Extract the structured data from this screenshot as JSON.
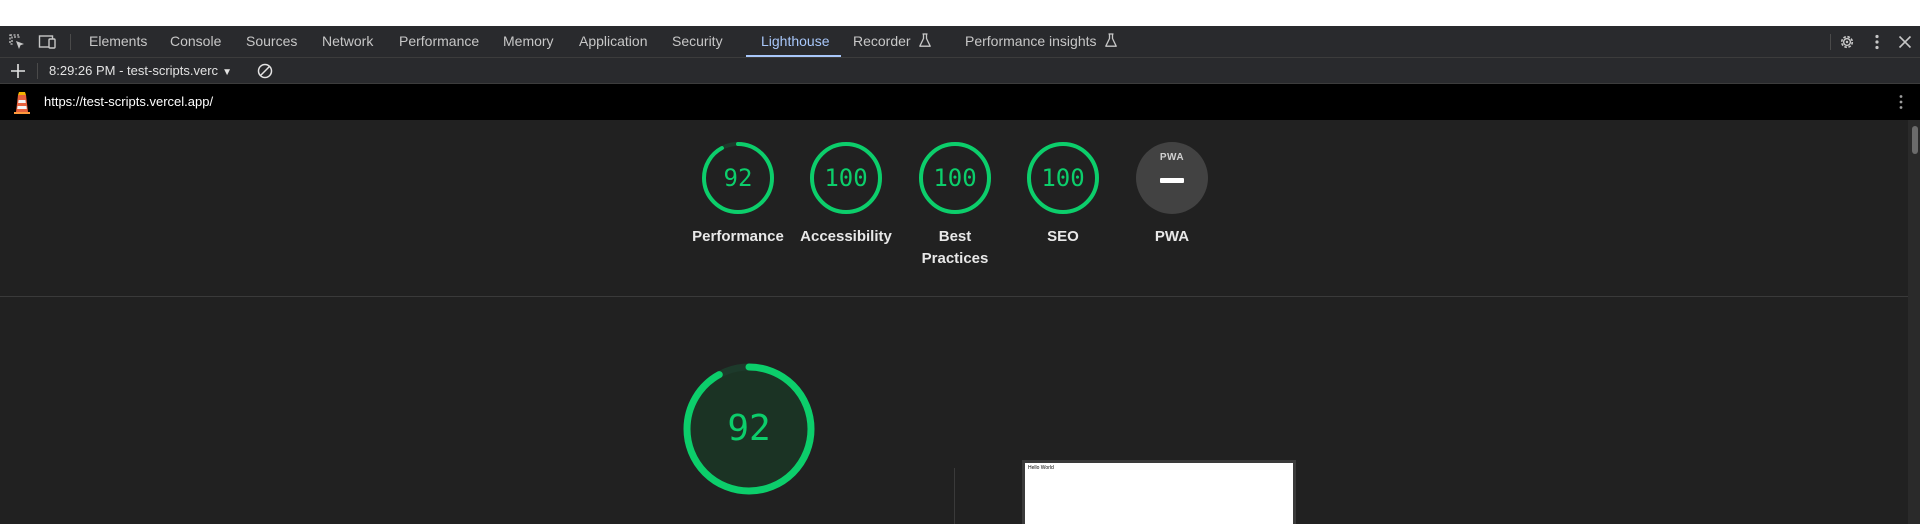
{
  "tabs": [
    {
      "label": "Elements"
    },
    {
      "label": "Console"
    },
    {
      "label": "Sources"
    },
    {
      "label": "Network"
    },
    {
      "label": "Performance"
    },
    {
      "label": "Memory"
    },
    {
      "label": "Application"
    },
    {
      "label": "Security"
    },
    {
      "label": "Lighthouse",
      "active": true
    },
    {
      "label": "Recorder",
      "icon": "flask-icon"
    },
    {
      "label": "Performance insights",
      "icon": "flask-icon"
    }
  ],
  "toolbar": {
    "report_label": "8:29:26 PM - test-scripts.verc",
    "icons": [
      "plus-icon",
      "caret-down-icon",
      "clear-icon"
    ]
  },
  "header_icons": [
    "inspect-element-icon",
    "device-toggle-icon",
    "settings-gear-icon",
    "more-vertical-icon",
    "close-icon"
  ],
  "url_bar": {
    "url": "https://test-scripts.vercel.app/",
    "icons": [
      "lighthouse-logo-icon",
      "more-vertical-icon"
    ]
  },
  "scores": [
    {
      "id": "performance",
      "value": "92",
      "fraction": 0.92,
      "label": "Performance"
    },
    {
      "id": "accessibility",
      "value": "100",
      "fraction": 1.0,
      "label": "Accessibility"
    },
    {
      "id": "best-practices",
      "value": "100",
      "fraction": 1.0,
      "label": "Best Practices"
    },
    {
      "id": "seo",
      "value": "100",
      "fraction": 1.0,
      "label": "SEO"
    },
    {
      "id": "pwa",
      "badge": "PWA",
      "label": "PWA"
    }
  ],
  "main_gauge": {
    "value": "92",
    "fraction": 0.92
  },
  "screenshot": {
    "text": "Hello World"
  },
  "colors": {
    "pass": "#0cce6b",
    "accent": "#a8c7fa",
    "background": "#212121"
  }
}
